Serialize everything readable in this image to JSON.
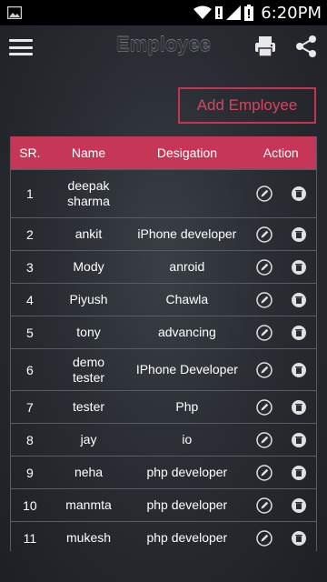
{
  "status": {
    "time": "6:20PM",
    "icons": [
      "image-icon",
      "wifi-icon",
      "alert-icon",
      "signal-icon",
      "battery-icon"
    ]
  },
  "appbar": {
    "title": "Employee",
    "menu_icon": "menu-icon",
    "print_icon": "print-icon",
    "share_icon": "share-icon"
  },
  "add_button": {
    "label": "Add Employee"
  },
  "colors": {
    "accent": "#c63657",
    "background": "#2a2e34",
    "statusbar": "#000000"
  },
  "table": {
    "headers": {
      "sr": "SR.",
      "name": "Name",
      "designation": "Desigation",
      "action": "Action"
    },
    "action_icons": [
      "edit-icon",
      "delete-icon"
    ],
    "rows": [
      {
        "sr": "1",
        "name": "deepak sharma",
        "designation": ""
      },
      {
        "sr": "2",
        "name": "ankit",
        "designation": "iPhone developer"
      },
      {
        "sr": "3",
        "name": "Mody",
        "designation": "anroid"
      },
      {
        "sr": "4",
        "name": "Piyush",
        "designation": "Chawla"
      },
      {
        "sr": "5",
        "name": "tony",
        "designation": "advancing"
      },
      {
        "sr": "6",
        "name": "demo tester",
        "designation": "IPhone Developer"
      },
      {
        "sr": "7",
        "name": "tester",
        "designation": "Php"
      },
      {
        "sr": "8",
        "name": "jay",
        "designation": "io"
      },
      {
        "sr": "9",
        "name": "neha",
        "designation": "php developer"
      },
      {
        "sr": "10",
        "name": "manmta",
        "designation": "php developer"
      },
      {
        "sr": "11",
        "name": "mukesh",
        "designation": "php developer"
      }
    ]
  }
}
